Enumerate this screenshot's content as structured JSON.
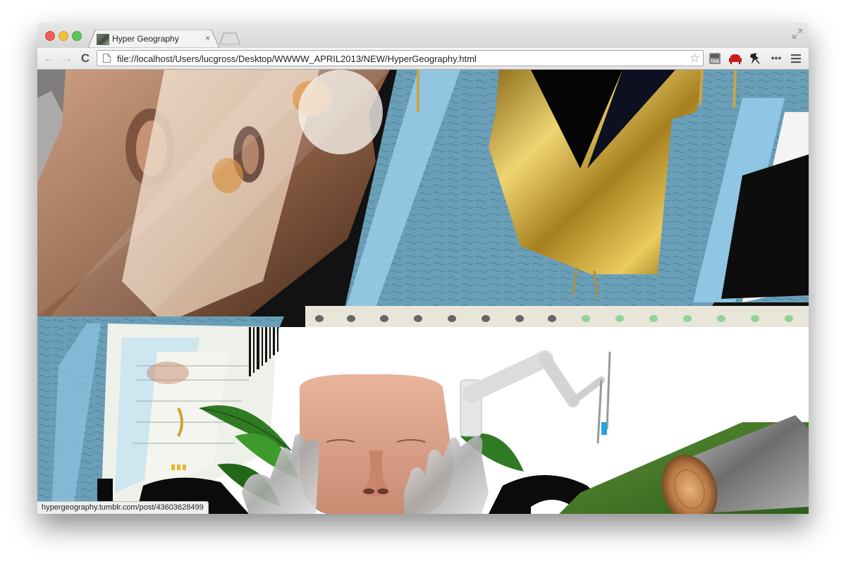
{
  "browser": {
    "tab": {
      "title": "Hyper Geography",
      "close_glyph": "×",
      "favicon": "collage-thumbnail-icon"
    },
    "toolbar": {
      "back_glyph": "←",
      "forward_glyph": "→",
      "reload_glyph": "C",
      "url": "file://localhost/Users/lucgross/Desktop/WWWW_APRIL2013/NEW/HyperGeography.html",
      "star_glyph": "☆",
      "extensions": [
        "tag-extension-icon",
        "sofa-extension-icon",
        "pushpin-extension-icon",
        "more-extensions-icon"
      ],
      "more_glyph": "•••",
      "menu_icon": "hamburger-menu-icon"
    },
    "status_bar": {
      "text": "hypergeography.tumblr.com/post/43603628499"
    }
  },
  "colors": {
    "sky_blue": "#7ab6d6",
    "gold": "#d8b34a",
    "skin": "#d9a88a",
    "grass": "#4f8a2e",
    "black": "#0b0b0b"
  }
}
